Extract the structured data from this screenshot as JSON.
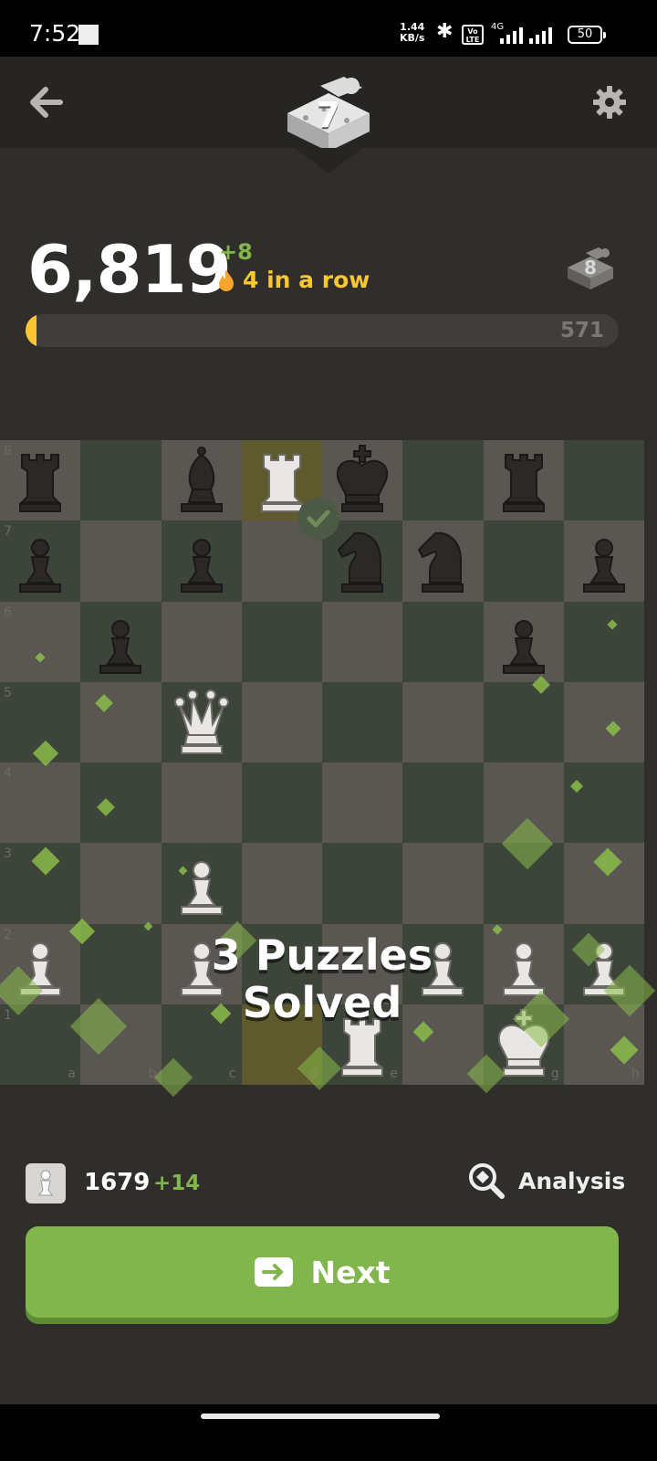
{
  "status_bar": {
    "time": "7:52",
    "speed_value": "1.44",
    "speed_unit": "KB/s",
    "volte": "Vo LTE",
    "network": "4G",
    "battery": "50"
  },
  "header": {
    "puzzle_streak_level": "7"
  },
  "score": {
    "value": "6,819",
    "delta": "+8",
    "streak_label": "4 in a row",
    "next_level": "8",
    "progress_remaining": "571",
    "progress_fraction": 0.014
  },
  "board": {
    "overlay_line1": "3 Puzzles",
    "overlay_line2": "Solved",
    "rank_labels": [
      "8",
      "7",
      "6",
      "5",
      "4",
      "3",
      "2",
      "1"
    ],
    "file_labels": [
      "a",
      "b",
      "c",
      "d",
      "e",
      "f",
      "g",
      "h"
    ],
    "pieces": [
      {
        "square": "a8",
        "piece": "bR"
      },
      {
        "square": "c8",
        "piece": "bB"
      },
      {
        "square": "d8",
        "piece": "wR"
      },
      {
        "square": "e8",
        "piece": "bK"
      },
      {
        "square": "g8",
        "piece": "bR"
      },
      {
        "square": "a7",
        "piece": "bP"
      },
      {
        "square": "c7",
        "piece": "bP"
      },
      {
        "square": "e7",
        "piece": "bN"
      },
      {
        "square": "f7",
        "piece": "bN"
      },
      {
        "square": "h7",
        "piece": "bP"
      },
      {
        "square": "b6",
        "piece": "bP"
      },
      {
        "square": "g6",
        "piece": "bP"
      },
      {
        "square": "c5",
        "piece": "wQ"
      },
      {
        "square": "c3",
        "piece": "wP"
      },
      {
        "square": "a2",
        "piece": "wP"
      },
      {
        "square": "c2",
        "piece": "wP"
      },
      {
        "square": "f2",
        "piece": "wP"
      },
      {
        "square": "g2",
        "piece": "wP"
      },
      {
        "square": "h2",
        "piece": "wP"
      },
      {
        "square": "e1",
        "piece": "wR"
      },
      {
        "square": "g1",
        "piece": "wK"
      }
    ],
    "highlight_squares": [
      "d8",
      "d1"
    ]
  },
  "footer": {
    "rating": "1679",
    "rating_delta": "+14",
    "analysis_label": "Analysis",
    "next_label": "Next"
  },
  "colors": {
    "accent_green": "#81b64c",
    "streak_yellow": "#f7c631",
    "background": "#302e2b"
  },
  "icons": [
    "back-arrow-icon",
    "gear-icon",
    "puzzle-piece-icon",
    "flame-icon",
    "pawn-icon",
    "magnifier-icon",
    "arrow-right-icon"
  ]
}
